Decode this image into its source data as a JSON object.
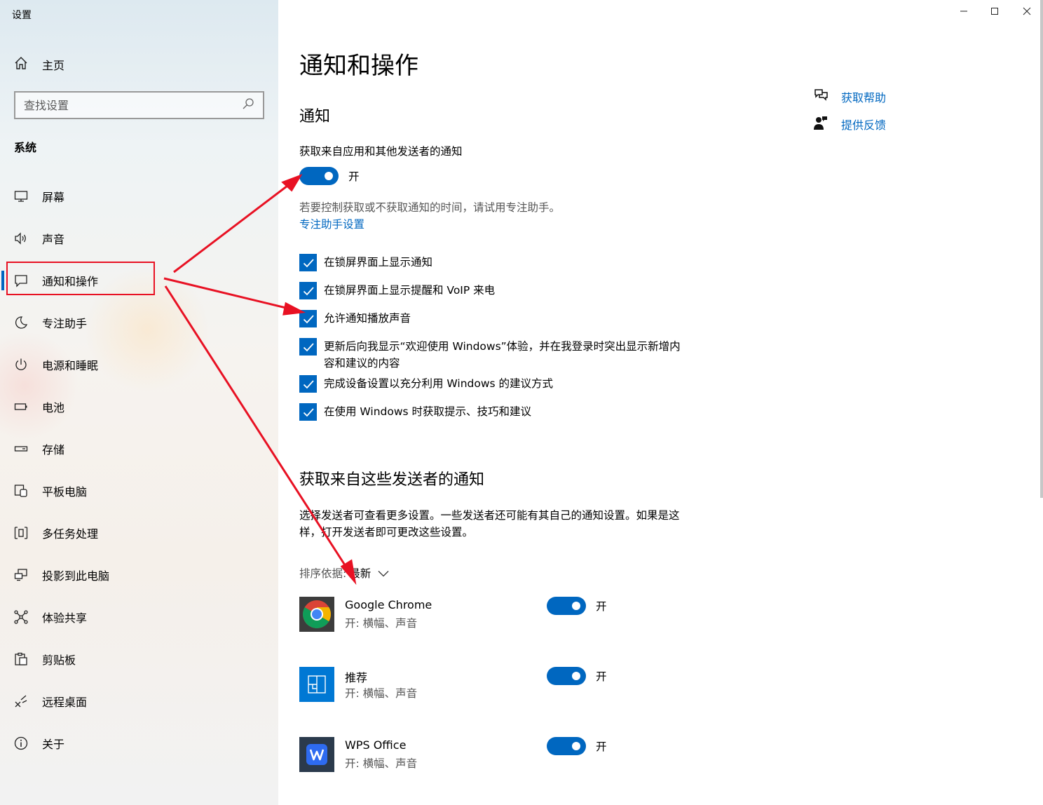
{
  "window": {
    "title": "设置",
    "minimize_glyph": "—",
    "maximize_glyph": "☐",
    "close_glyph": "✕"
  },
  "sidebar": {
    "home_label": "主页",
    "search_placeholder": "查找设置",
    "section_label": "系统",
    "items": [
      {
        "label": "屏幕",
        "icon": "display-icon"
      },
      {
        "label": "声音",
        "icon": "speaker-icon"
      },
      {
        "label": "通知和操作",
        "icon": "notification-icon",
        "active": true
      },
      {
        "label": "专注助手",
        "icon": "moon-icon"
      },
      {
        "label": "电源和睡眠",
        "icon": "power-icon"
      },
      {
        "label": "电池",
        "icon": "battery-icon"
      },
      {
        "label": "存储",
        "icon": "storage-icon"
      },
      {
        "label": "平板电脑",
        "icon": "tablet-icon"
      },
      {
        "label": "多任务处理",
        "icon": "multitask-icon"
      },
      {
        "label": "投影到此电脑",
        "icon": "project-icon"
      },
      {
        "label": "体验共享",
        "icon": "share-icon"
      },
      {
        "label": "剪贴板",
        "icon": "clipboard-icon"
      },
      {
        "label": "远程桌面",
        "icon": "remote-desktop-icon"
      },
      {
        "label": "关于",
        "icon": "info-icon"
      }
    ]
  },
  "main": {
    "title": "通知和操作",
    "section_notifications": "通知",
    "get_notifications_label": "获取来自应用和其他发送者的通知",
    "master_toggle_state": "开",
    "focus_hint": "若要控制获取或不获取通知的时间，请试用专注助手。",
    "focus_link": "专注助手设置",
    "checkboxes": [
      {
        "label": "在锁屏界面上显示通知",
        "checked": true
      },
      {
        "label": "在锁屏界面上显示提醒和 VoIP 来电",
        "checked": true
      },
      {
        "label": "允许通知播放声音",
        "checked": true
      },
      {
        "label": "更新后向我显示“欢迎使用 Windows”体验，并在我登录时突出显示新增内容和建议的内容",
        "checked": true
      },
      {
        "label": "完成设备设置以充分利用 Windows 的建议方式",
        "checked": true
      },
      {
        "label": "在使用 Windows 时获取提示、技巧和建议",
        "checked": true
      }
    ],
    "senders_heading": "获取来自这些发送者的通知",
    "senders_desc": "选择发送者可查看更多设置。一些发送者还可能有其自己的通知设置。如果是这样，打开发送者即可更改这些设置。",
    "sort_label": "排序依据:",
    "sort_value": "最新",
    "apps": [
      {
        "name": "Google Chrome",
        "sub": "开: 横幅、声音",
        "state": "开",
        "icon": "chrome-icon"
      },
      {
        "name": "推荐",
        "sub": "开: 横幅、声音",
        "state": "开",
        "icon": "recommend-icon"
      },
      {
        "name": "WPS Office",
        "sub": "开: 横幅、声音",
        "state": "开",
        "icon": "wps-icon"
      }
    ]
  },
  "help": {
    "get_help": "获取帮助",
    "feedback": "提供反馈"
  },
  "colors": {
    "accent": "#0067c0",
    "annotation_red": "#e81123"
  }
}
